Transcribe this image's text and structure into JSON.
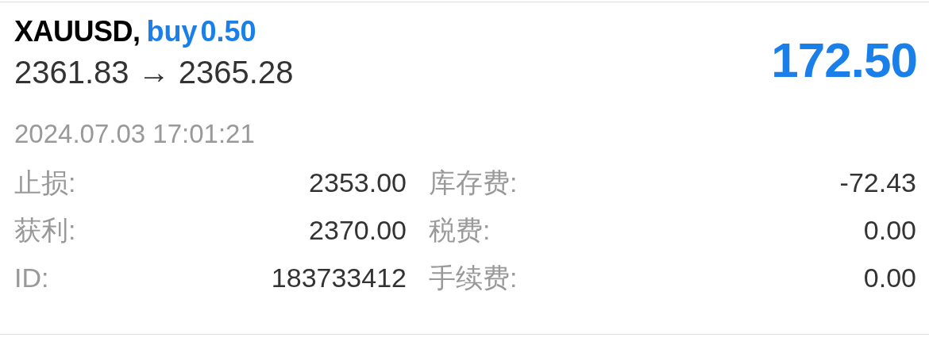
{
  "position": {
    "symbol": "XAUUSD,",
    "type": "buy",
    "volume": "0.50",
    "open_price": "2361.83",
    "arrow": "→",
    "current_price": "2365.28",
    "profit": "172.50",
    "time": "2024.07.03 17:01:21"
  },
  "details": [
    {
      "label": "止损:",
      "value": "2353.00"
    },
    {
      "label": "库存费:",
      "value": "-72.43"
    },
    {
      "label": "获利:",
      "value": "2370.00"
    },
    {
      "label": "税费:",
      "value": "0.00"
    },
    {
      "label": "ID:",
      "value": "183733412"
    },
    {
      "label": "手续费:",
      "value": "0.00"
    }
  ]
}
